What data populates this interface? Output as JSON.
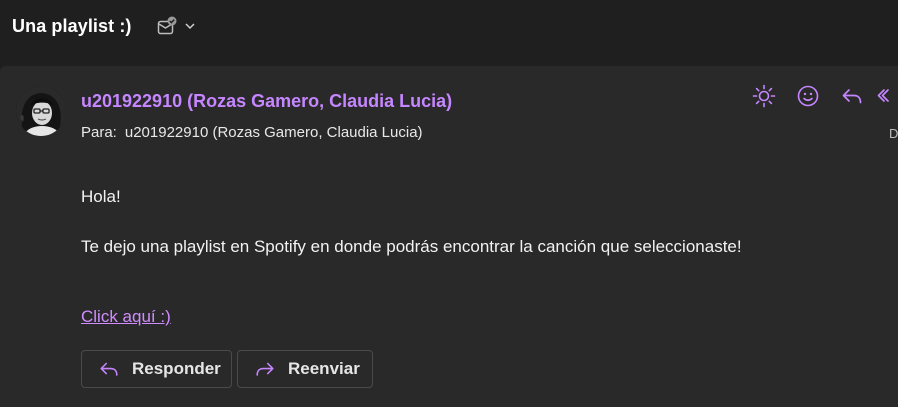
{
  "header": {
    "subject": "Una playlist :)",
    "icons": [
      "mail-check-icon",
      "chevron-down-icon"
    ]
  },
  "message": {
    "sender": "u201922910 (Rozas Gamero, Claudia Lucia)",
    "to_label": "Para:",
    "to_value": "u201922910 (Rozas Gamero, Claudia Lucia)",
    "date_partial": "D",
    "body": {
      "greeting": "Hola!",
      "paragraph": "Te dejo una playlist en Spotify en donde podrás encontrar la canción que seleccionaste!",
      "link_text": "Click aquí :)"
    },
    "actions": [
      "sun-icon",
      "emoji-icon",
      "reply-icon",
      "reply-all-icon"
    ]
  },
  "footer": {
    "reply_label": "Responder",
    "forward_label": "Reenviar"
  },
  "colors": {
    "accent": "#c586ff",
    "link": "#d08cff",
    "background": "#1f1f1f",
    "card": "#292929"
  }
}
